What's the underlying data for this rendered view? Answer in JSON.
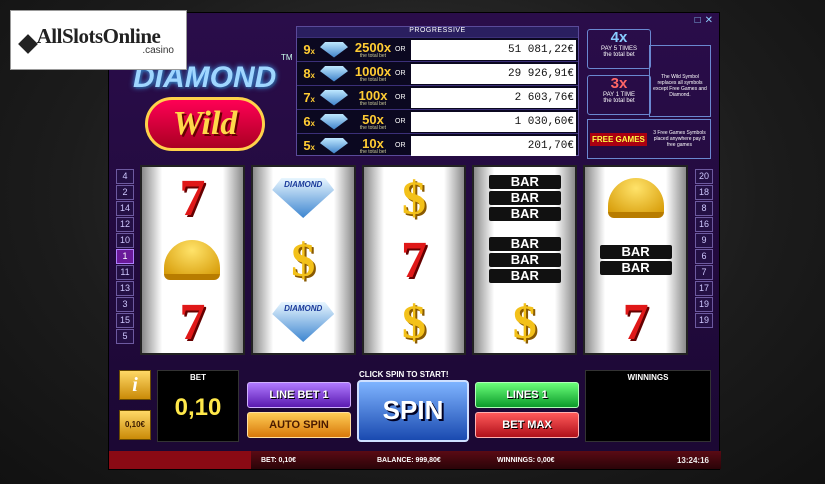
{
  "branding": {
    "name": "AllSlotsOnline",
    "sub": ".casino"
  },
  "game": {
    "title_top": "DIAMOND",
    "title_bottom": "Wild",
    "tm": "TM"
  },
  "window_icons": [
    "□",
    "✕"
  ],
  "progressive": {
    "header": "PROGRESSIVE",
    "or_label": "OR",
    "sub_label": "the total bet",
    "rows": [
      {
        "count": "9",
        "x": "2500x",
        "value": "51 081,22€"
      },
      {
        "count": "8",
        "x": "1000x",
        "value": "29 926,91€"
      },
      {
        "count": "7",
        "x": "100x",
        "value": "2 603,76€"
      },
      {
        "count": "6",
        "x": "50x",
        "value": "1 030,60€"
      },
      {
        "count": "5",
        "x": "10x",
        "value": "201,70€"
      }
    ]
  },
  "info_panels": {
    "pay5": {
      "mult": "4x",
      "line1": "PAY 5 TIMES",
      "line2": "the total bet"
    },
    "pay1": {
      "mult": "3x",
      "line1": "PAY 1 TIME",
      "line2": "the total bet"
    },
    "wild_text": "The Wild Symbol replaces all symbols except Free Games and Diamond.",
    "free_games_label": "FREE GAMES",
    "free_text": "3 Free Games Symbols placed anywhere pay 8 free games"
  },
  "lines_left": [
    "4",
    "2",
    "14",
    "12",
    "10",
    "1",
    "11",
    "13",
    "3",
    "15",
    "5"
  ],
  "lines_right": [
    "20",
    "18",
    "8",
    "16",
    "9",
    "6",
    "7",
    "17",
    "19",
    "19"
  ],
  "active_line": "1",
  "reels": [
    [
      "seven",
      "bell",
      "seven"
    ],
    [
      "diamond",
      "dollar",
      "diamond"
    ],
    [
      "dollar",
      "seven",
      "dollar"
    ],
    [
      "bar3",
      "bar3",
      "dollar"
    ],
    [
      "bell",
      "bar2",
      "seven"
    ]
  ],
  "symbol_labels": {
    "diamond": "DIAMOND",
    "bar": "BAR",
    "seven": "7",
    "dollar": "$"
  },
  "controls": {
    "info": "i",
    "coin": "0,10€",
    "bet_label": "BET",
    "bet_value": "0,10",
    "click_hint": "CLICK SPIN TO START!",
    "line_bet": "LINE BET 1",
    "auto_spin": "AUTO SPIN",
    "spin": "SPIN",
    "lines": "LINES 1",
    "bet_max": "BET MAX",
    "winnings_label": "WINNINGS"
  },
  "status": {
    "bet": "BET: 0,10€",
    "balance": "BALANCE: 999,80€",
    "winnings": "WINNINGS: 0,00€",
    "time": "13:24:16"
  },
  "colors": {
    "accent_purple": "#5a1ab0",
    "gold": "#ffcc33",
    "spin_blue": "#1a4ab0"
  }
}
